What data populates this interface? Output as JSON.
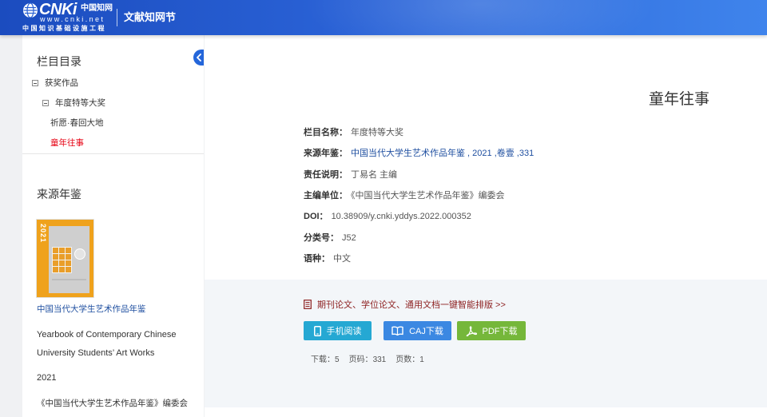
{
  "theme": {
    "header_start": "#1b4cbf",
    "header_end": "#3f84ec",
    "link": "#1f4fa0",
    "active_item": "#e60012",
    "promo_text": "#8c1f1f",
    "panel_bg": "#f3f6f9"
  },
  "header": {
    "logo": {
      "icon": "globe-icon",
      "brand": "CNKi",
      "name_cn": "中国知网",
      "url": "www.cnki.net",
      "tagline": "中国知识基础设施工程"
    },
    "section_title": "文献知网节"
  },
  "sidebar": {
    "toggle_icon": "chevron-left-icon",
    "catalog": {
      "title": "栏目目录",
      "tree": [
        {
          "label": "获奖作品",
          "expanded": true,
          "icon": "collapse-minus-icon",
          "children": [
            {
              "label": "年度特等大奖",
              "expanded": true,
              "icon": "collapse-minus-icon",
              "children": [
                {
                  "label": "祈愿·春回大地",
                  "active": false
                },
                {
                  "label": "童年往事",
                  "active": true
                }
              ]
            }
          ]
        }
      ]
    },
    "source": {
      "title": "来源年鉴",
      "cover_year": "2021",
      "name": "中国当代大学生艺术作品年鉴",
      "english_name_lines": [
        "Yearbook of Contemporary Chinese",
        "University Students’ Art Works"
      ],
      "year": "2021",
      "editor": "《中国当代大学生艺术作品年鉴》编委会"
    }
  },
  "article": {
    "title": "童年往事",
    "fields": [
      {
        "label": "栏目名称：",
        "value": "年度特等大奖"
      },
      {
        "label": "来源年鉴：",
        "value": "中国当代大学生艺术作品年鉴 , 2021 ,卷壹 ,331",
        "is_link": true
      },
      {
        "label": "责任说明：",
        "value": "丁易名 主编"
      },
      {
        "label": "主编单位：",
        "value": "《中国当代大学生艺术作品年鉴》编委会"
      },
      {
        "label": "DOI：",
        "value": "10.38909/y.cnki.yddys.2022.000352"
      },
      {
        "label": "分类号：",
        "value": "J52"
      },
      {
        "label": "语种：",
        "value": "中文"
      }
    ]
  },
  "download_panel": {
    "promo": {
      "icon": "document-icon",
      "text": "期刊论文、学位论文、通用文档一键智能排版 >>"
    },
    "buttons": [
      {
        "label": "手机阅读",
        "icon": "mobile-phone-icon",
        "color": "#25a8d3"
      },
      {
        "label": "CAJ下载",
        "icon": "open-book-icon",
        "color": "#3b88e2"
      },
      {
        "label": "PDF下载",
        "icon": "acrobat-pdf-icon",
        "color": "#75b73a"
      }
    ],
    "stats": [
      {
        "label": "下载：",
        "value": "5"
      },
      {
        "label": "页码：",
        "value": "331"
      },
      {
        "label": "页数：",
        "value": "1"
      }
    ]
  }
}
